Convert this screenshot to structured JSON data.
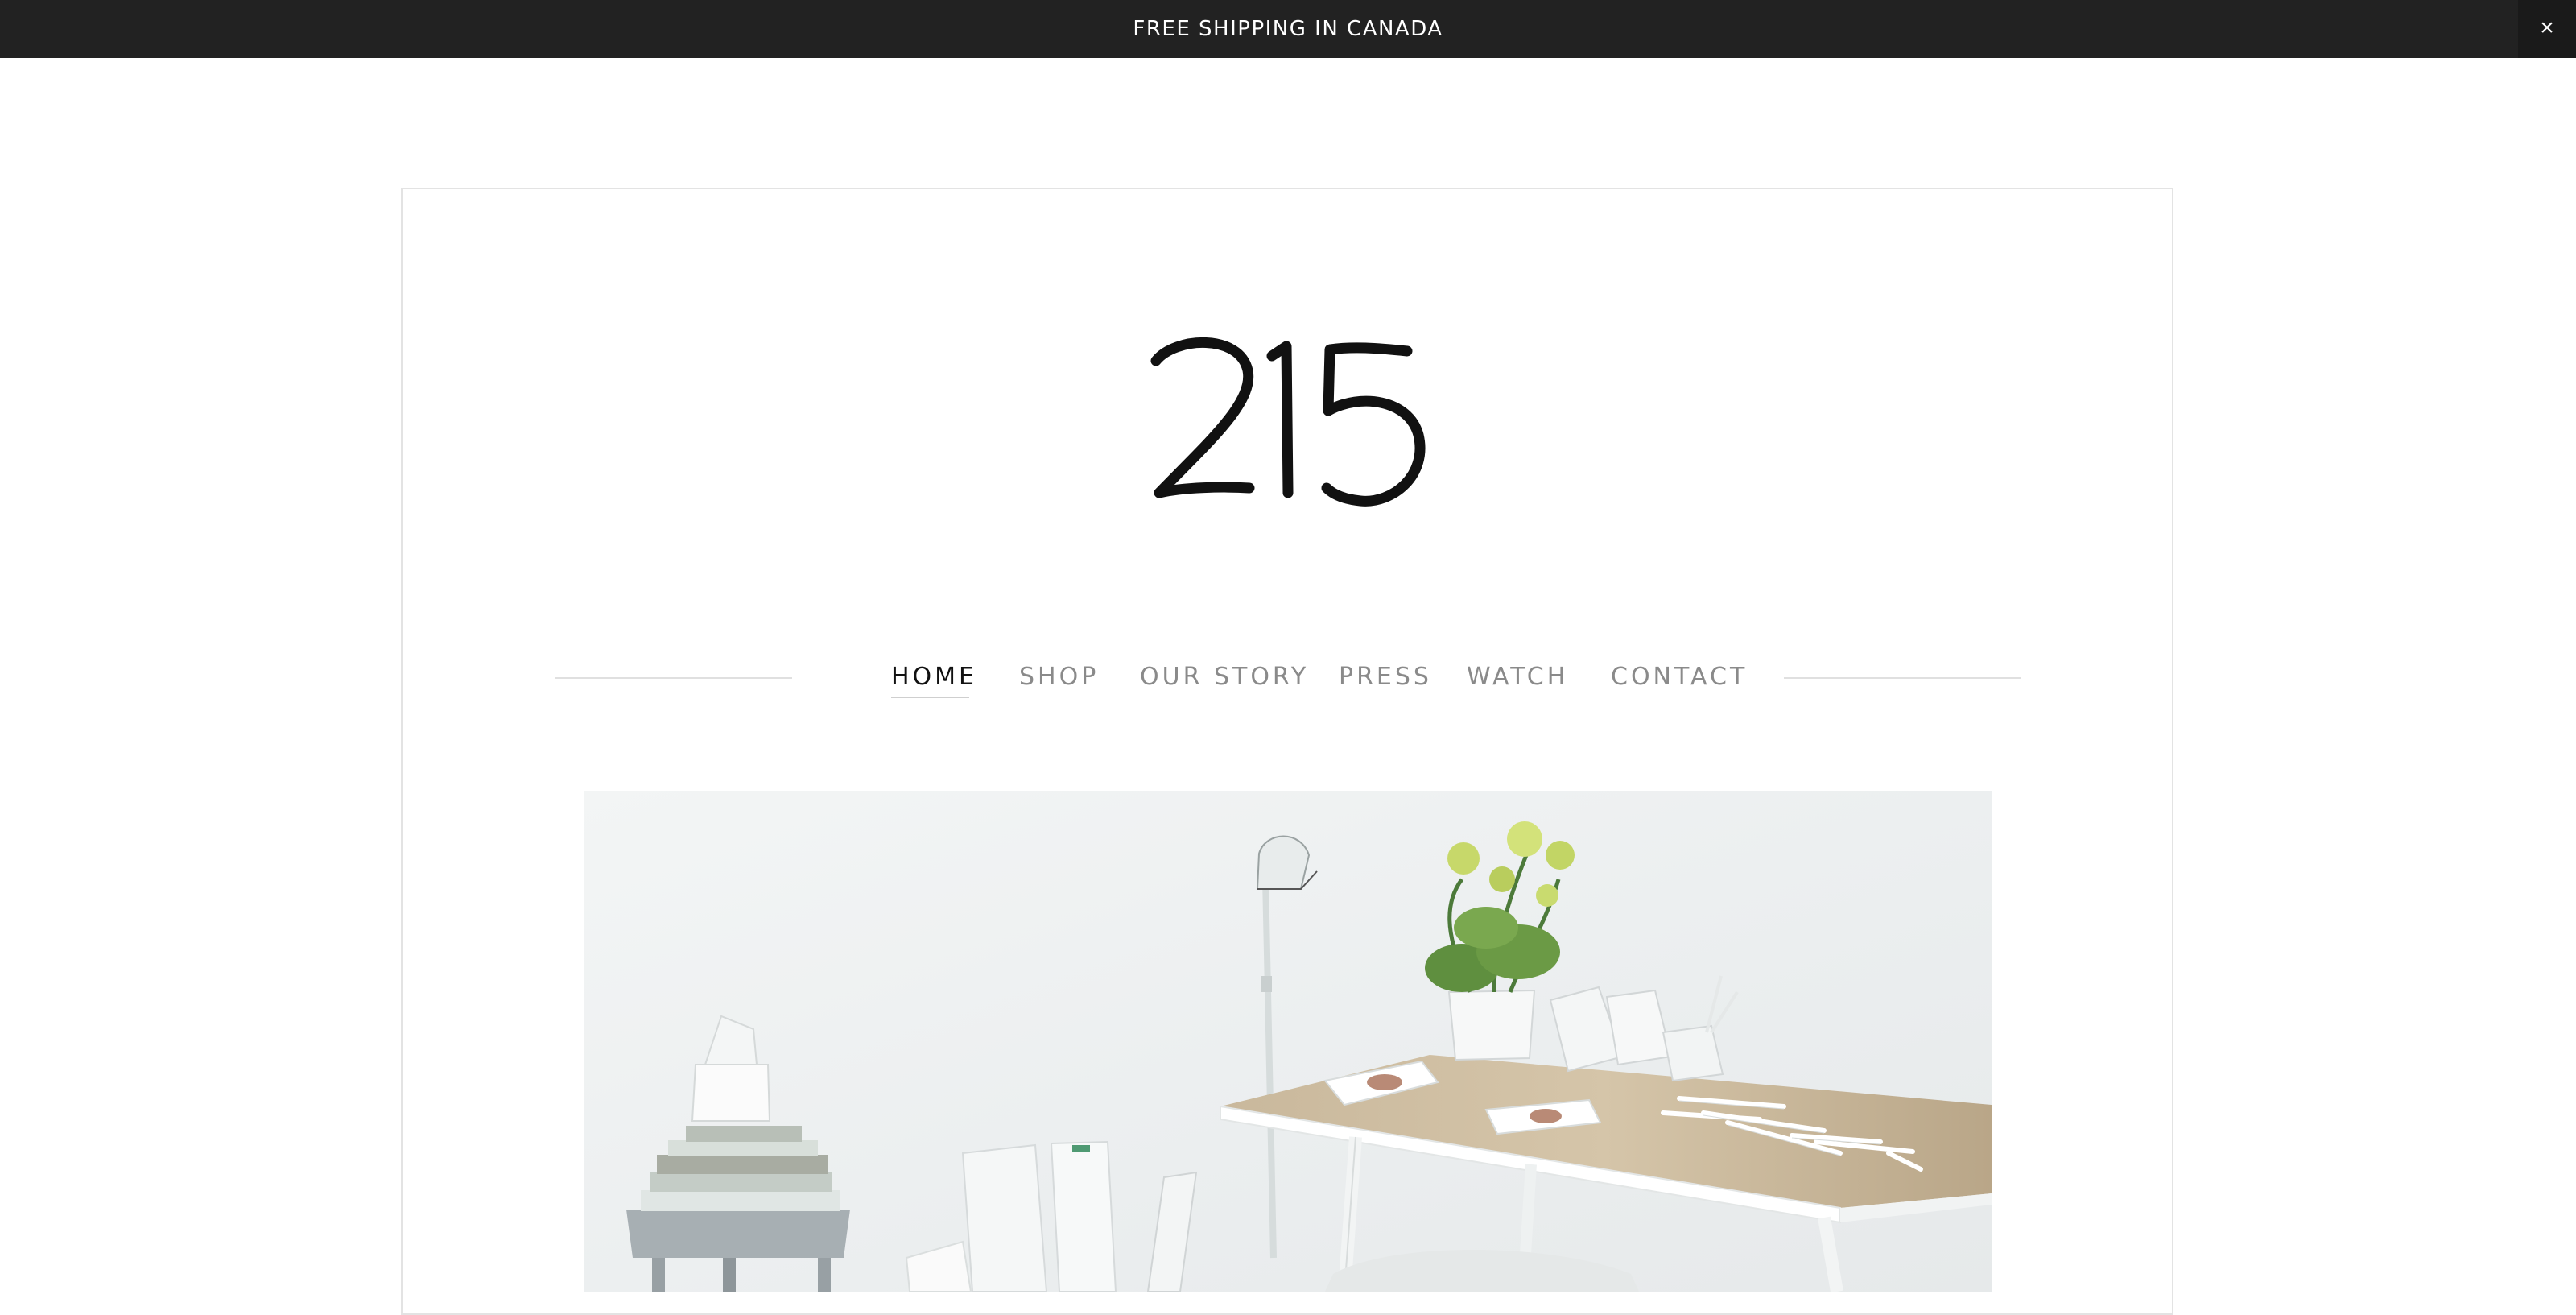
{
  "announcement": {
    "text": "FREE SHIPPING IN CANADA",
    "close_label": "×"
  },
  "brand": {
    "logo_text": "215"
  },
  "nav": {
    "items": [
      {
        "label": "HOME",
        "active": true
      },
      {
        "label": "SHOP",
        "active": false
      },
      {
        "label": "OUR STORY",
        "active": false
      },
      {
        "label": "PRESS",
        "active": false
      },
      {
        "label": "WATCH",
        "active": false
      },
      {
        "label": "CONTACT",
        "active": false
      }
    ]
  },
  "colors": {
    "announcement_bg": "#222222",
    "nav_active": "#111111",
    "nav_inactive": "#8a8a8a",
    "frame_border": "#e3e3e3"
  }
}
